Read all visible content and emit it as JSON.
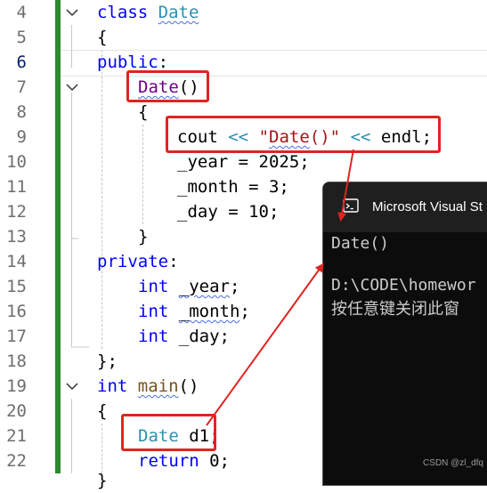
{
  "line_numbers": [
    "4",
    "5",
    "6",
    "7",
    "8",
    "9",
    "10",
    "11",
    "12",
    "13",
    "14",
    "15",
    "16",
    "17",
    "18",
    "19",
    "20",
    "21",
    "22"
  ],
  "code": {
    "l4_kw": "class",
    "l4_name": "Date",
    "l5": "{",
    "l6_kw": "public",
    "l6_colon": ":",
    "l7_name": "Date",
    "l7_parens": "()",
    "l8": "{",
    "l9_cout": "cout",
    "l9_op1": "<<",
    "l9_str_open": "\"",
    "l9_str_body": "Date",
    "l9_str_close": "()\"",
    "l9_op2": "<<",
    "l9_endl": "endl;",
    "l10": "_year = 2025;",
    "l11": "_month = 3;",
    "l12": "_day = 10;",
    "l13": "}",
    "l14_kw": "private",
    "l14_colon": ":",
    "l15_kw": "int",
    "l15_var": "_year",
    "l15_semi": ";",
    "l16_kw": "int",
    "l16_var": "_month",
    "l16_semi": ";",
    "l17_kw": "int",
    "l17_rest": "_day;",
    "l18": "};",
    "l19_kw": "int",
    "l19_name": "main",
    "l19_parens": "()",
    "l20": "{",
    "l21_type": "Date",
    "l21_rest": "d1;",
    "l22_kw": "return",
    "l22_rest": "0;"
  },
  "console": {
    "title": "Microsoft Visual St",
    "line1": "Date()",
    "line2": "D:\\CODE\\homewor",
    "line3": "按任意键关闭此窗"
  },
  "watermark": "CSDN @zl_dfq",
  "colors": {
    "keyword": "#0000ff",
    "type": "#2b91af",
    "string": "#a31515",
    "highlight": "#e0241f",
    "gutter_bar": "#2e8b2e"
  }
}
